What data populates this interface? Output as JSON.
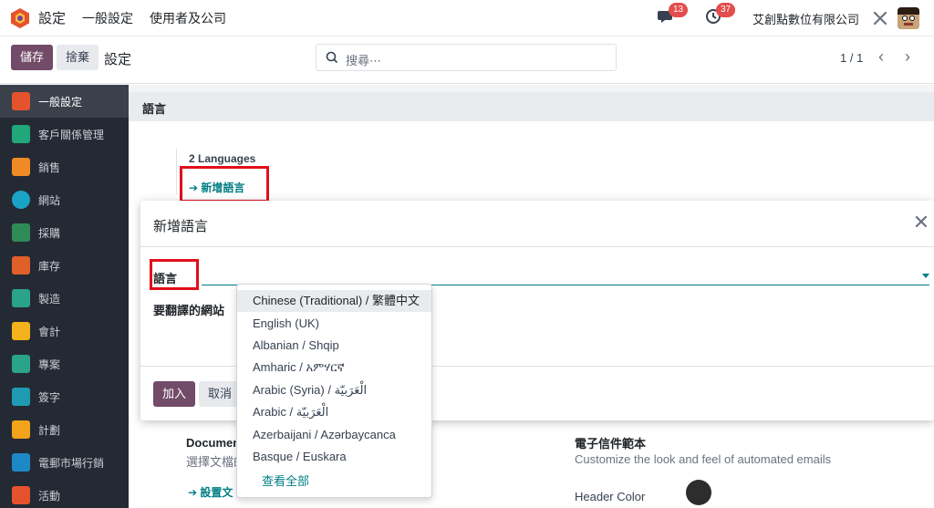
{
  "topbar": {
    "app_title": "設定",
    "menu": [
      "一般設定",
      "使用者及公司"
    ],
    "messages_count": "13",
    "activities_count": "37",
    "company": "艾創點數位有限公司"
  },
  "control": {
    "save_label": "儲存",
    "discard_label": "捨棄",
    "title": "設定",
    "search_placeholder": "搜尋⋯",
    "pager": "1 / 1"
  },
  "sidebar": {
    "items": [
      {
        "label": "一般設定",
        "color": "#e5532d"
      },
      {
        "label": "客戶關係管理",
        "color": "#20a87a"
      },
      {
        "label": "銷售",
        "color": "#f08a24"
      },
      {
        "label": "網站",
        "color": "#1ba3c6"
      },
      {
        "label": "採購",
        "color": "#2e8b57"
      },
      {
        "label": "庫存",
        "color": "#e0602a"
      },
      {
        "label": "製造",
        "color": "#2aa38a"
      },
      {
        "label": "會計",
        "color": "#f2b21b"
      },
      {
        "label": "專案",
        "color": "#2aa38a"
      },
      {
        "label": "簽字",
        "color": "#1e9bb3"
      },
      {
        "label": "計劃",
        "color": "#f2a31b"
      },
      {
        "label": "電郵市場行銷",
        "color": "#1e88c7"
      },
      {
        "label": "活動",
        "color": "#e5532d"
      }
    ]
  },
  "main": {
    "section_title": "語言",
    "lang_count": "2 Languages",
    "add_lang_link": "➔ 新增語言",
    "bottom_left_title": "Documen",
    "bottom_left_sub": "選擇文檔的",
    "bottom_left_link": "➔ 設置文",
    "bottom_right_title": "電子信件範本",
    "bottom_right_sub": "Customize the look and feel of automated emails",
    "header_color_label": "Header Color"
  },
  "modal": {
    "title": "新增語言",
    "field_language": "語言",
    "field_websites": "要翻譯的網站",
    "add_label": "加入",
    "cancel_label": "取消"
  },
  "dropdown": {
    "options": [
      "Chinese (Traditional) / 繁體中文",
      "English (UK)",
      "Albanian / Shqip",
      "Amharic / አምሃርኛ",
      "Arabic (Syria) / الْعَرَبيّة",
      "Arabic / الْعَرَبيّة",
      "Azerbaijani / Azərbaycanca",
      "Basque / Euskara"
    ],
    "view_all": "查看全部"
  },
  "colors": {
    "brand": "#714b67",
    "accent": "#017e84",
    "highlight": "#e0101a"
  }
}
